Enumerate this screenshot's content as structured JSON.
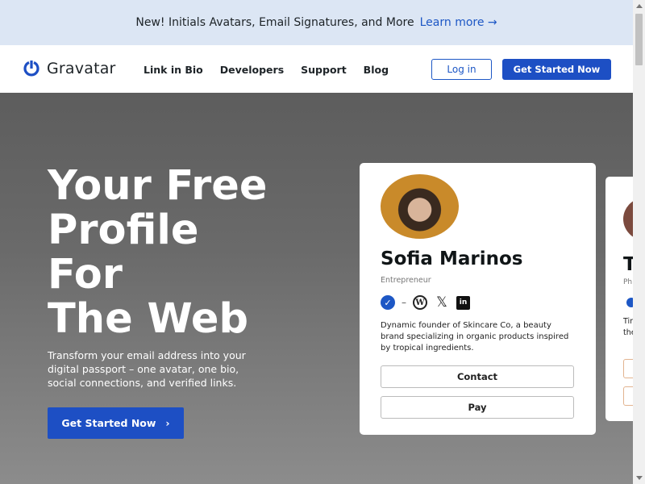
{
  "banner": {
    "text": "New! Initials Avatars, Email Signatures, and More",
    "link": "Learn more →"
  },
  "nav": {
    "logo_text": "Gravatar",
    "items": [
      "Link in Bio",
      "Developers",
      "Support",
      "Blog"
    ],
    "login": "Log in",
    "get_started": "Get Started Now"
  },
  "hero": {
    "title_lines": [
      "Your Free",
      "Profile",
      "For",
      "The Web"
    ],
    "subtitle": "Transform your email address into your digital passport – one avatar, one bio, social connections, and verified links.",
    "cta": "Get Started Now",
    "cta_arrow": "›"
  },
  "profile_card": {
    "name": "Sofia Marinos",
    "role": "Entrepreneur",
    "bio": "Dynamic founder of Skincare Co, a beauty brand specializing in organic products inspired by tropical ingredients.",
    "buttons": [
      "Contact",
      "Pay"
    ],
    "icons": [
      "verified-badge-icon",
      "wordpress-icon",
      "x-icon",
      "linkedin-icon"
    ]
  },
  "profile_card_2": {
    "name_partial": "T",
    "role_partial": "Ph",
    "bio_partial": [
      "Tir",
      "the"
    ]
  },
  "colors": {
    "accent": "#1d4fc4",
    "banner_bg": "#dce6f4"
  }
}
